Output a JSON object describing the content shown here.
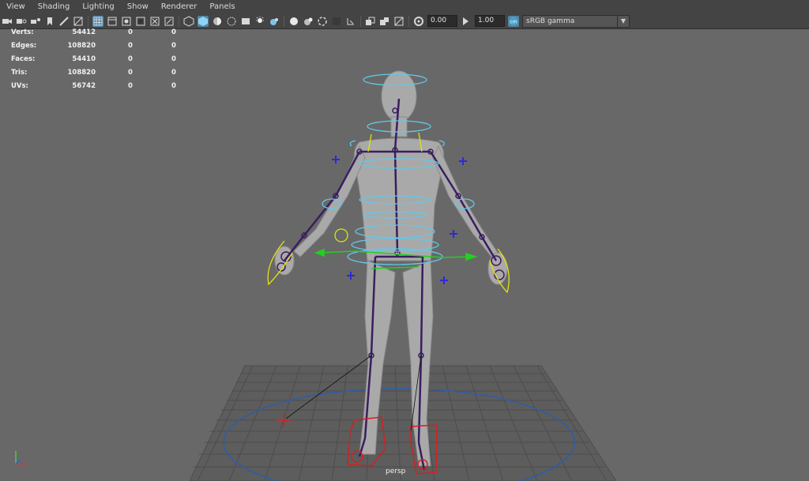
{
  "menu": [
    "View",
    "Shading",
    "Lighting",
    "Show",
    "Renderer",
    "Panels"
  ],
  "toolbar": {
    "icons": [
      "camera-icon",
      "camera-attribute-icon",
      "bookmark-icon",
      "image-plane-icon",
      "grid-icon",
      "film-gate-icon",
      "resolution-gate-icon",
      "field-chart-icon",
      "safe-action-icon",
      "wireframe-icon",
      "smooth-shade-icon",
      "default-material-icon",
      "textures-icon",
      "lights-icon",
      "shadows-icon",
      "ambient-occlusion-icon",
      "motion-blur-icon",
      "anti-aliasing-icon",
      "depth-of-field-icon",
      "isolate-select-icon",
      "xray-icon",
      "xray-joints-icon",
      "backface-icon",
      "exposure-icon",
      "gamma-icon",
      "color-management-icon"
    ],
    "exposure_value": "0.00",
    "gamma_value": "1.00",
    "color_space": "sRGB gamma"
  },
  "hud": [
    {
      "label": "Verts:",
      "v1": "54412",
      "v2": "0",
      "v3": "0"
    },
    {
      "label": "Edges:",
      "v1": "108820",
      "v2": "0",
      "v3": "0"
    },
    {
      "label": "Faces:",
      "v1": "54410",
      "v2": "0",
      "v3": "0"
    },
    {
      "label": "Tris:",
      "v1": "108820",
      "v2": "0",
      "v3": "0"
    },
    {
      "label": "UVs:",
      "v1": "56742",
      "v2": "0",
      "v3": "0"
    }
  ],
  "camera_label": "persp",
  "colors": {
    "background": "#686868",
    "grid": "#505050",
    "mesh": "#a9a9a9",
    "skeleton": "#3a1e5e",
    "controls_cyan": "#62c8e8",
    "controls_yellow": "#e4e20c",
    "controls_blue": "#2a2ad8",
    "controls_red": "#d81e1e",
    "controls_green": "#22d020",
    "ground_circle": "#2b5ea8",
    "accent": "#5285a6"
  }
}
